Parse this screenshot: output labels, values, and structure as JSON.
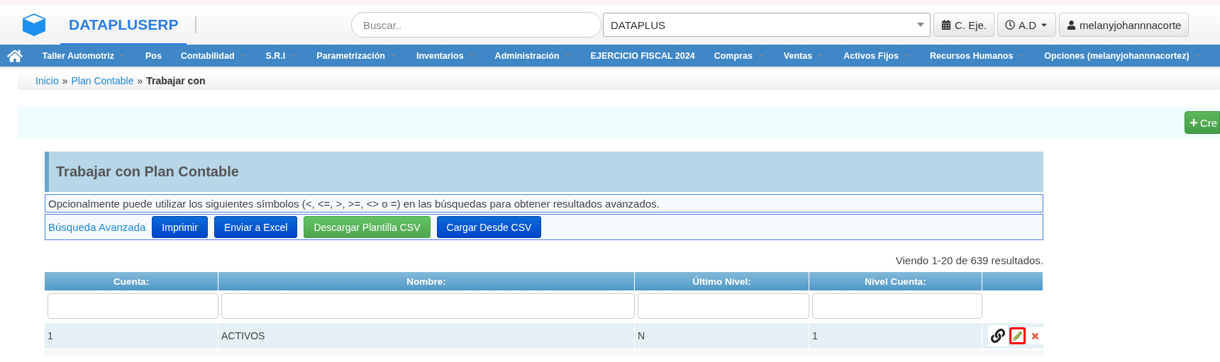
{
  "brand": {
    "title": "DATAPLUSERP"
  },
  "search": {
    "placeholder": "Buscar.."
  },
  "company_select": {
    "value": "DATAPLUS"
  },
  "header_buttons": [
    {
      "kind": "calendar",
      "label": "C. Eje.",
      "caret": false
    },
    {
      "kind": "clock",
      "label": "A.D",
      "caret": true
    },
    {
      "kind": "user",
      "label": "melanyjohannnacorte",
      "caret": false
    }
  ],
  "nav": [
    {
      "label": "Taller Automotriz",
      "caret": true
    },
    {
      "label": "Pos",
      "caret": false
    },
    {
      "label": "Contabilidad",
      "caret": true
    },
    {
      "label": "S.R.I",
      "caret": true
    },
    {
      "label": "Parametrización",
      "caret": true
    },
    {
      "label": "Inventarios",
      "caret": true
    },
    {
      "label": "Administración",
      "caret": true
    },
    {
      "label": "EJERCICIO FISCAL 2024",
      "caret": false
    },
    {
      "label": "Compras",
      "caret": true
    },
    {
      "label": "Ventas",
      "caret": true
    },
    {
      "label": "Activos Fijos",
      "caret": true
    },
    {
      "label": "Recursos Humanos",
      "caret": true
    },
    {
      "label": "Opciones (melanyjohannnacortez)",
      "caret": true
    }
  ],
  "breadcrumb": [
    {
      "label": "Inicio",
      "link": true
    },
    {
      "label": "»",
      "link": false,
      "separator": true
    },
    {
      "label": "Plan Contable",
      "link": true
    },
    {
      "label": "»",
      "link": false,
      "separator": true
    },
    {
      "label": "Trabajar con",
      "link": false,
      "separator": false
    }
  ],
  "create_button": {
    "label": "Cre"
  },
  "panel": {
    "title": "Trabajar con Plan Contable",
    "hint": "Opcionalmente puede utilizar los siguientes símbolos (<, <=, >, >=, <> o =) en las búsquedas para obtener resultados avanzados.",
    "advanced_search": "Búsqueda Avanzada",
    "buttons": [
      {
        "label": "Imprimir",
        "kind": "primary"
      },
      {
        "label": "Enviar a Excel",
        "kind": "primary"
      },
      {
        "label": "Descargar Plantilla CSV",
        "kind": "success"
      },
      {
        "label": "Cargar Desde CSV",
        "kind": "primary"
      }
    ]
  },
  "summary": "Viendo 1-20 de 639 resultados.",
  "table": {
    "columns": [
      {
        "label": "Cuenta:",
        "filter": true
      },
      {
        "label": "Nombre:",
        "filter": true
      },
      {
        "label": "Último Nivel:",
        "filter": true
      },
      {
        "label": "Nivel Cuenta:",
        "filter": true
      },
      {}
    ],
    "rows": [
      {
        "cells": [
          "1",
          "ACTIVOS",
          "N",
          "1"
        ],
        "actions": [
          {
            "kind": "link",
            "highlighted": false
          },
          {
            "kind": "edit",
            "highlighted": true
          },
          {
            "kind": "delete",
            "highlighted": false
          }
        ]
      }
    ]
  }
}
